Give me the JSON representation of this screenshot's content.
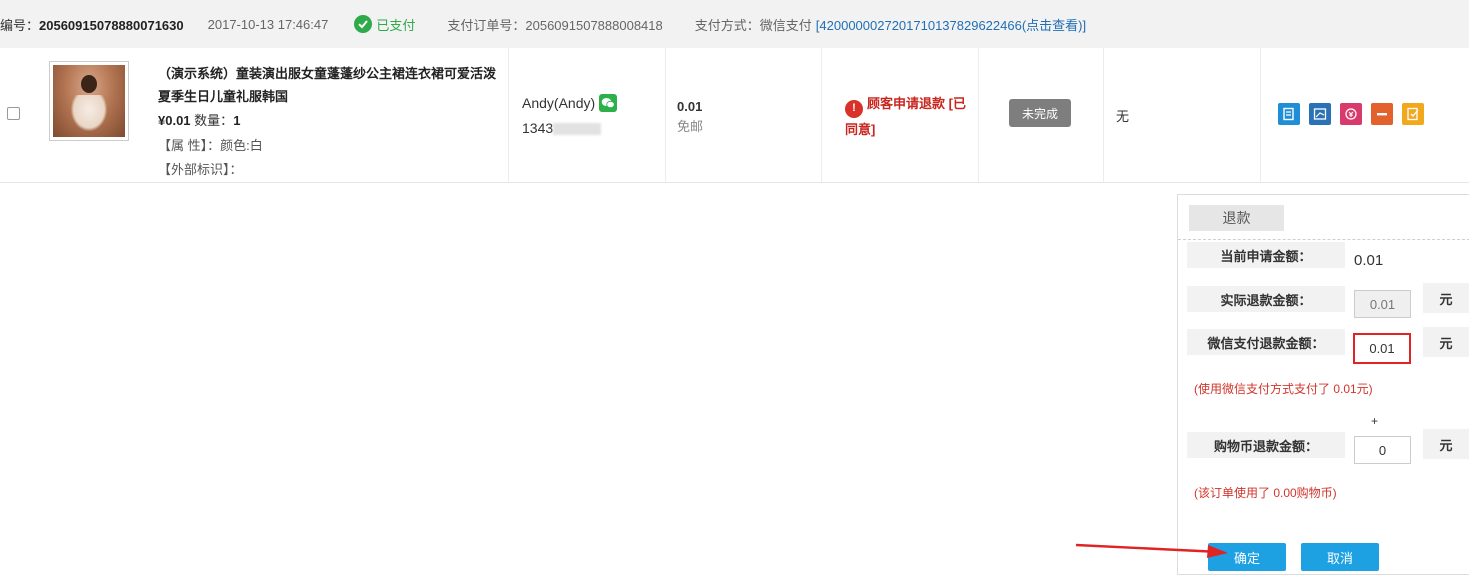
{
  "header": {
    "order_no_label": "编号：",
    "order_no_value": "20560915078880071630",
    "time": "2017-10-13 17:46:47",
    "paid_status": "已支付",
    "pay_order_label": "支付订单号：",
    "pay_order_value": "2056091507888008418",
    "pay_method_label": "支付方式：",
    "pay_method_value": "微信支付",
    "transaction_link": "[4200000027201710137829622466(点击查看)]"
  },
  "item": {
    "title": "（演示系统）童装演出服女童蓬蓬纱公主裙连衣裙可爱活泼夏季生日儿童礼服韩国",
    "price": "¥0.01",
    "qty_label": "数量：",
    "qty_value": "1",
    "attr": "【属 性】：颜色:白",
    "external_id": "【外部标识】：",
    "buyer_name": "Andy(Andy)",
    "buyer_phone_prefix": "1343",
    "amount": "0.01",
    "shipping": "免邮",
    "refund_status": "顾客申请退款 [已同意]",
    "completion_status": "未完成",
    "remark": "无"
  },
  "refund": {
    "tab_label": "退款",
    "current_label": "当前申请金额：",
    "current_value": "0.01",
    "actual_label": "实际退款金额：",
    "actual_value": "0.01",
    "wechat_label": "微信支付退款金额：",
    "wechat_value": "0.01",
    "unit": "元",
    "wechat_note": "(使用微信支付方式支付了 0.01元)",
    "plus": "+",
    "coin_label": "购物币退款金额：",
    "coin_value": "0",
    "coin_note": "(该订单使用了 0.00购物币)",
    "confirm_label": "确定",
    "cancel_label": "取消"
  },
  "colors": {
    "accent_blue": "#1ea1e3",
    "paid_green": "#2eaa4a",
    "alert_red": "#c8261f",
    "annotation_red": "#e02424"
  },
  "icons": [
    "edit-icon",
    "print-icon",
    "refund-icon",
    "minus-icon",
    "note-icon"
  ]
}
